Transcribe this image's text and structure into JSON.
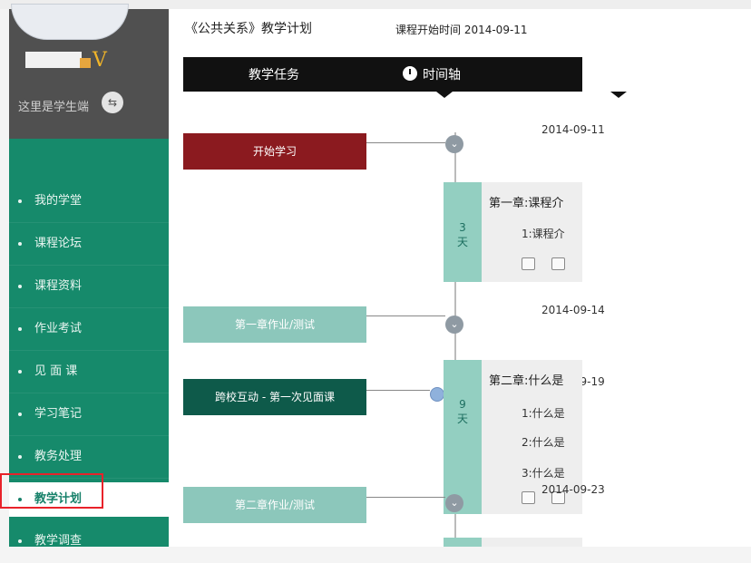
{
  "sidebar": {
    "vip_mark": "V",
    "role_text": "这里是学生端",
    "swap_icon": "swap-icon",
    "items": [
      {
        "label": "我的学堂"
      },
      {
        "label": "课程论坛"
      },
      {
        "label": "课程资料"
      },
      {
        "label": "作业考试"
      },
      {
        "label": "见 面 课"
      },
      {
        "label": "学习笔记"
      },
      {
        "label": "教务处理"
      },
      {
        "label": "教学计划"
      },
      {
        "label": "教学调查"
      }
    ],
    "active_item": "教学计划"
  },
  "page": {
    "title": "《公共关系》教学计划",
    "start_label": "课程开始时间 2014-09-11"
  },
  "header": {
    "tasks_label": "教学任务",
    "timeline_label": "时间轴"
  },
  "timeline": {
    "tasks": [
      {
        "label": "开始学习",
        "date": "2014-09-11"
      },
      {
        "label": "第一章作业/测试",
        "date": "2014-09-14"
      },
      {
        "label": "跨校互动 - 第一次见面课",
        "date": "2014-09-19"
      },
      {
        "label": "第二章作业/测试",
        "date": "2014-09-23"
      }
    ],
    "durations": [
      {
        "num": "3",
        "unit": "天"
      },
      {
        "num": "9",
        "unit": "天"
      }
    ],
    "chapters": [
      {
        "title": "第一章:课程介",
        "lines": [
          "1:课程介"
        ]
      },
      {
        "title": "第二章:什么是",
        "lines": [
          "1:什么是",
          "2:什么是",
          "3:什么是"
        ]
      }
    ]
  },
  "colors": {
    "sidebar_green": "#168a6b",
    "start_red": "#8b1a1f",
    "light_teal": "#8cc7bb",
    "dark_teal": "#0e5a4a",
    "highlight_red": "#e8222a"
  }
}
